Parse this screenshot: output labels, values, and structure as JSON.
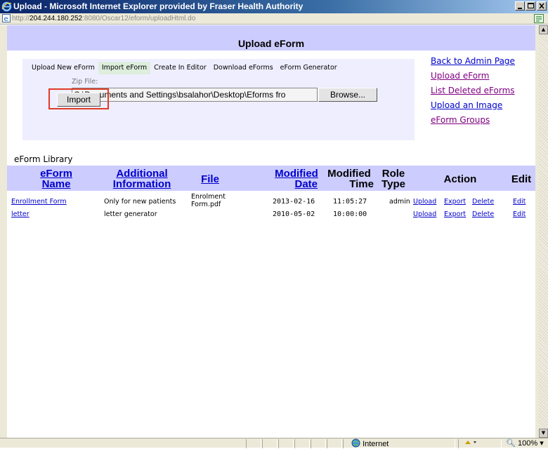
{
  "window": {
    "title": "Upload - Microsoft Internet Explorer provided by Fraser Health Authority",
    "url_prefix": "http://",
    "url_host": "204.244.180.252",
    "url_rest": ":8080/Oscar12/eform/uploadHtml.do"
  },
  "page": {
    "title": "Upload eForm"
  },
  "tabs": [
    {
      "label": "Upload New eForm"
    },
    {
      "label": "Import eForm"
    },
    {
      "label": "Create In Editor"
    },
    {
      "label": "Download eForms"
    },
    {
      "label": "eForm Generator"
    }
  ],
  "upload": {
    "zip_label": "Zip File:",
    "file_value": "C:\\Documents and Settings\\bsalahor\\Desktop\\Eforms fro",
    "browse_label": "Browse...",
    "import_label": "Import"
  },
  "side_links": [
    {
      "label": "Back to Admin Page"
    },
    {
      "label": "Upload eForm"
    },
    {
      "label": "List Deleted eForms"
    },
    {
      "label": "Upload an Image"
    },
    {
      "label": "eForm Groups"
    }
  ],
  "library": {
    "title": "eForm Library",
    "columns": {
      "name_1": "eForm",
      "name_2": "Name",
      "info_1": "Additional",
      "info_2": "Information",
      "file": "File",
      "mdate_1": "Modified",
      "mdate_2": "Date",
      "mtime_1": "Modified",
      "mtime_2": "Time",
      "role_1": "Role",
      "role_2": "Type",
      "action": "Action",
      "edit": "Edit"
    },
    "rows": [
      {
        "name": "Enrollment Form",
        "info": "Only for new patients",
        "file_1": "Enrolment",
        "file_2": "Form.pdf",
        "date": "2013-02-16",
        "time": "11:05:27",
        "role": "admin",
        "upload": "Upload",
        "export": "Export",
        "delete": "Delete",
        "edit": "Edit"
      },
      {
        "name": "letter",
        "info": "letter generator",
        "file_1": "",
        "file_2": "",
        "date": "2010-05-02",
        "time": "10:00:00",
        "role": "",
        "upload": "Upload",
        "export": "Export",
        "delete": "Delete",
        "edit": "Edit"
      }
    ]
  },
  "status": {
    "zone": "Internet",
    "zoom": "100%"
  }
}
